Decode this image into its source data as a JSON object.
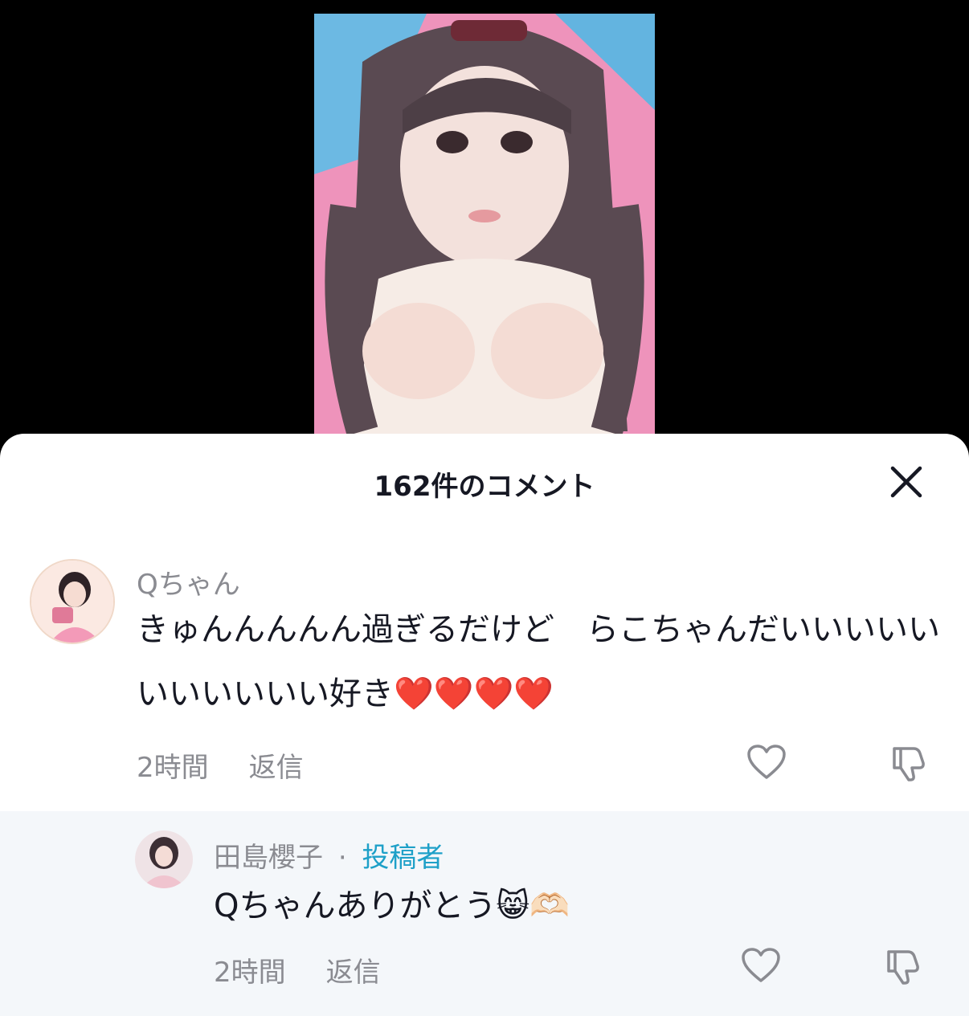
{
  "sheet": {
    "title": "162件のコメント"
  },
  "comments": [
    {
      "username": "Qちゃん",
      "text": "きゅんんんんん過ぎるだけど　らこちゃんだいいいいいいいいいいい好き❤️❤️❤️❤️",
      "time": "2時間",
      "reply_label": "返信"
    }
  ],
  "replies": [
    {
      "username": "田島櫻子",
      "separator": "·",
      "author_tag": "投稿者",
      "text": "Qちゃんありがとう😸🫶🏻",
      "time": "2時間",
      "reply_label": "返信"
    }
  ],
  "colors": {
    "accent": "#1ea0c8",
    "muted": "#8a8b91",
    "text": "#161823",
    "reply_bg": "#f4f7fa"
  },
  "icons": [
    "close-icon",
    "heart-icon",
    "dislike-icon"
  ]
}
